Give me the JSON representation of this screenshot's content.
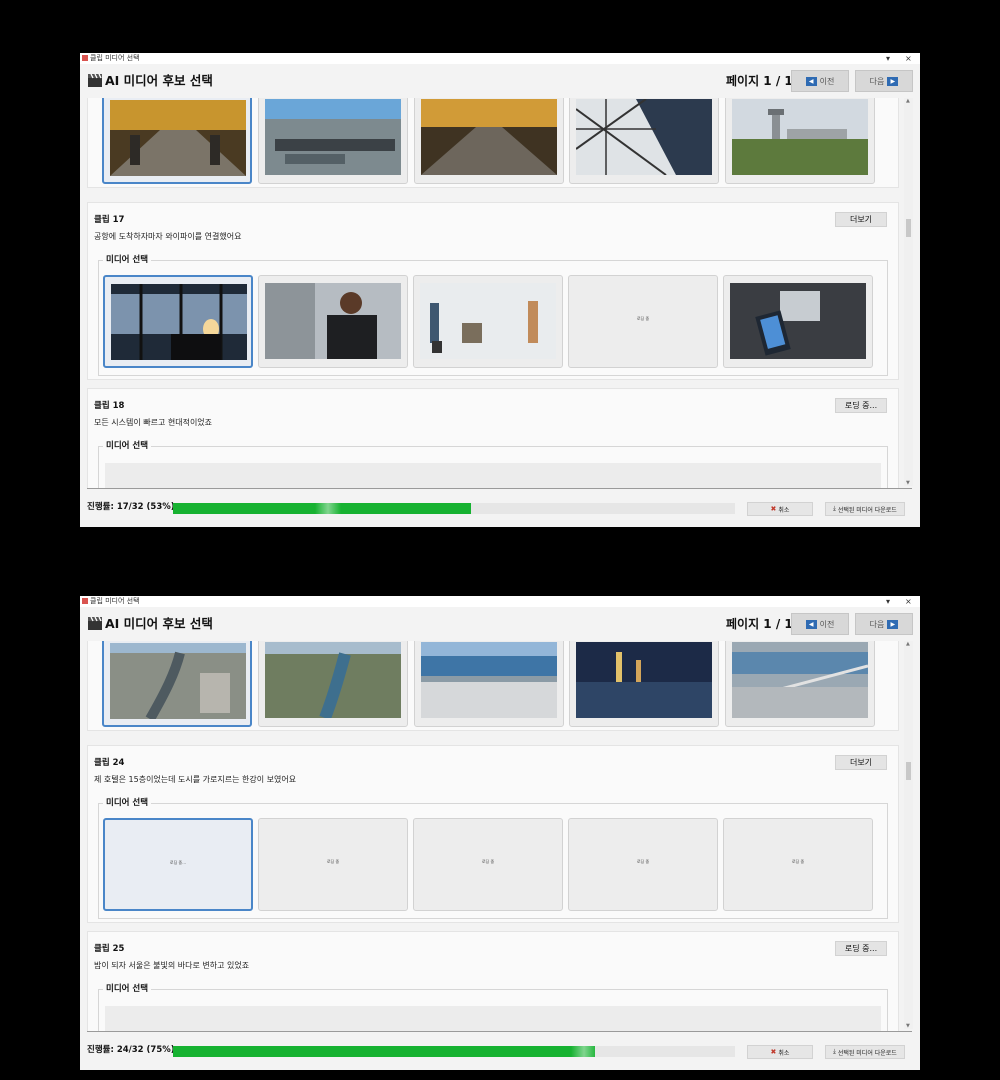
{
  "windows": [
    {
      "titlebar": {
        "title": "클립 미디어 선택",
        "min": "▾",
        "close": "×"
      },
      "header": {
        "title": "AI 미디어 후보 선택",
        "page_info": "페이지 1 / 1",
        "prev": "이전",
        "next": "다음"
      },
      "clips": [
        {
          "label": "클립 17",
          "text": "공항에 도착하자마자 와이파이를 연결했어요",
          "button": "더보기",
          "group_title": "미디어 선택",
          "thumbs": [
            {
              "kind": "terminal"
            },
            {
              "kind": "people"
            },
            {
              "kind": "travelers"
            },
            {
              "kind": "loading",
              "text": "로딩 중"
            },
            {
              "kind": "phone"
            }
          ]
        },
        {
          "label": "클립 18",
          "text": "모든 시스템이 빠르고 현대적이었죠",
          "button": "로딩 중...",
          "group_title": "미디어 선택"
        }
      ],
      "top_row": [
        {
          "kind": "hall"
        },
        {
          "kind": "airport"
        },
        {
          "kind": "hall"
        },
        {
          "kind": "roof"
        },
        {
          "kind": "tower"
        }
      ],
      "progress": {
        "label": "진행률: 17/32 (53%)",
        "percent": 53
      },
      "footer": {
        "cancel": "취소",
        "download": "선택된 미디어 다운로드"
      }
    },
    {
      "titlebar": {
        "title": "클립 미디어 선택",
        "min": "▾",
        "close": "×"
      },
      "header": {
        "title": "AI 미디어 후보 선택",
        "page_info": "페이지 1 / 1",
        "prev": "이전",
        "next": "다음"
      },
      "clips": [
        {
          "label": "클립 24",
          "text": "제 호텔은 15층이었는데 도시를 가로지르는 한강이 보였어요",
          "button": "더보기",
          "group_title": "미디어 선택",
          "thumbs": [
            {
              "kind": "loading",
              "text": "로딩 중..."
            },
            {
              "kind": "loading",
              "text": "로딩 중"
            },
            {
              "kind": "loading",
              "text": "로딩 중"
            },
            {
              "kind": "loading",
              "text": "로딩 중"
            },
            {
              "kind": "loading",
              "text": "로딩 중"
            }
          ]
        },
        {
          "label": "클립 25",
          "text": "밤이 되자 서울은 불빛의 바다로 변하고 있었죠",
          "button": "로딩 중...",
          "group_title": "미디어 선택"
        }
      ],
      "top_row": [
        {
          "kind": "city"
        },
        {
          "kind": "river"
        },
        {
          "kind": "bay"
        },
        {
          "kind": "night"
        },
        {
          "kind": "bridge"
        }
      ],
      "progress": {
        "label": "진행률: 24/32 (75%)",
        "percent": 75
      },
      "footer": {
        "cancel": "취소",
        "download": "선택된 미디어 다운로드"
      }
    }
  ]
}
